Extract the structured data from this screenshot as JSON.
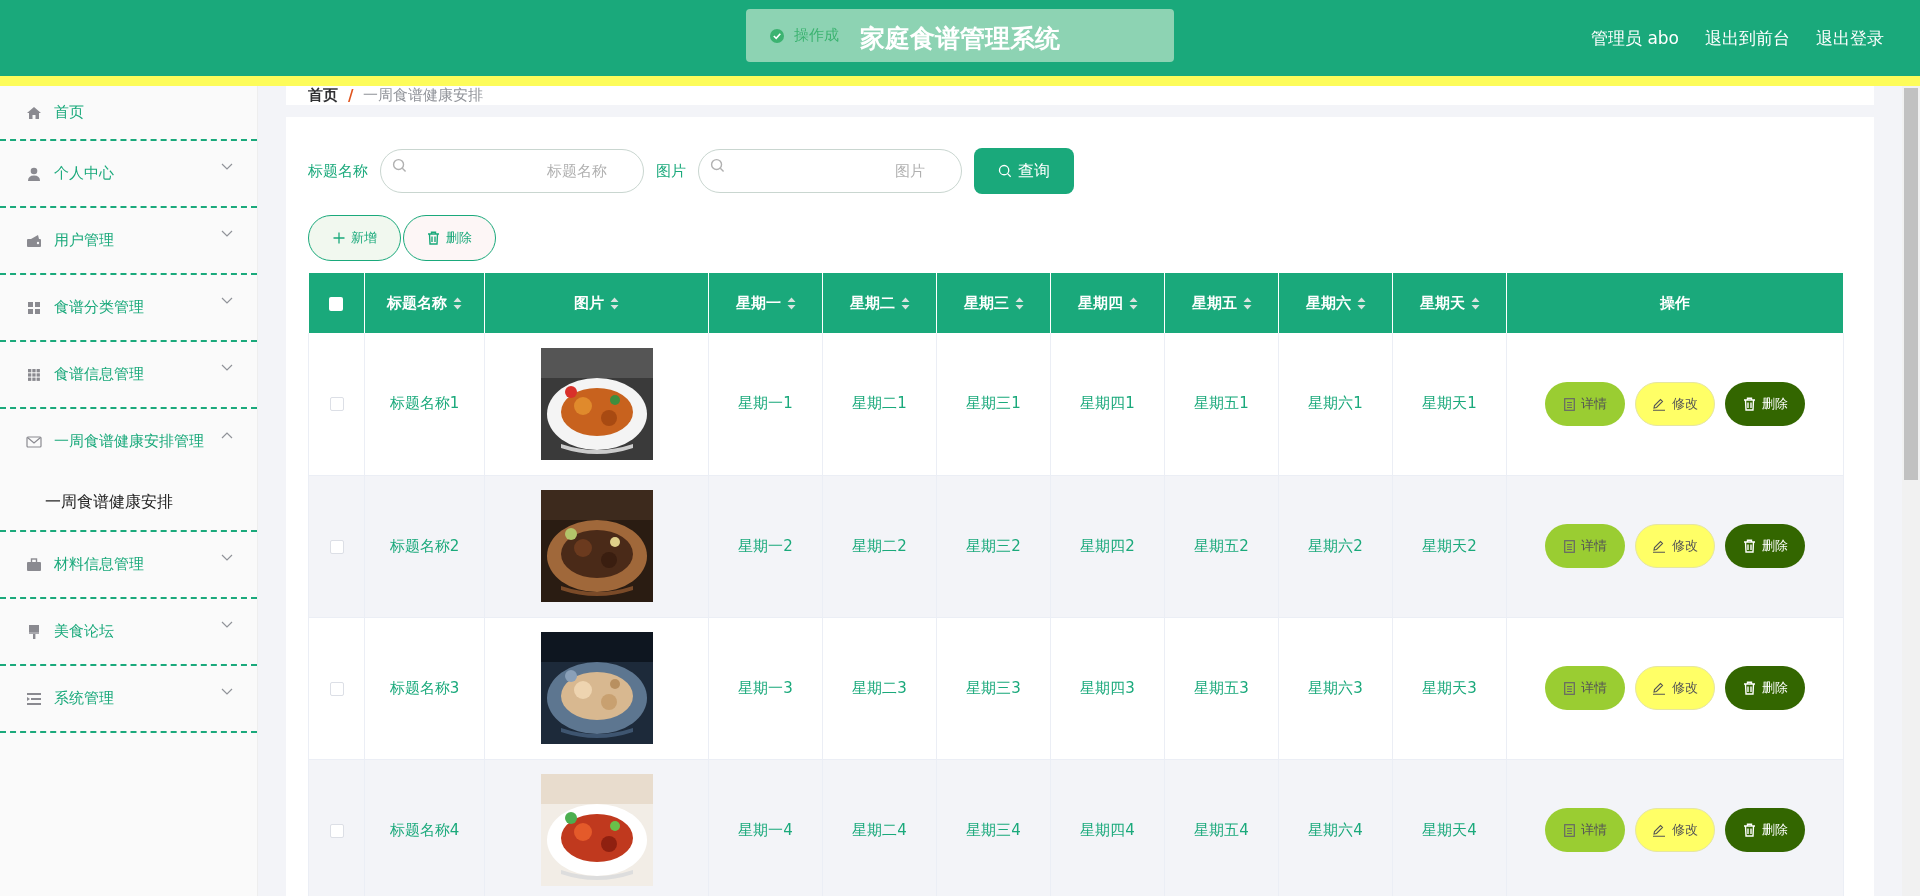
{
  "header": {
    "title": "家庭食谱管理系统",
    "toast": {
      "text": "操作成"
    },
    "links": [
      "管理员 abo",
      "退出到前台",
      "退出登录"
    ]
  },
  "sidebar": {
    "items": [
      {
        "label": "首页",
        "kind": "link"
      },
      {
        "label": "个人中心",
        "kind": "menu",
        "expanded": false
      },
      {
        "label": "用户管理",
        "kind": "menu",
        "expanded": false
      },
      {
        "label": "食谱分类管理",
        "kind": "menu",
        "expanded": false
      },
      {
        "label": "食谱信息管理",
        "kind": "menu",
        "expanded": false
      },
      {
        "label": "一周食谱健康安排管理",
        "kind": "menu",
        "expanded": true,
        "children": [
          {
            "label": "一周食谱健康安排"
          }
        ]
      },
      {
        "label": "材料信息管理",
        "kind": "menu",
        "expanded": false
      },
      {
        "label": "美食论坛",
        "kind": "menu",
        "expanded": false
      },
      {
        "label": "系统管理",
        "kind": "menu",
        "expanded": false
      }
    ]
  },
  "breadcrumb": [
    "首页",
    "一周食谱健康安排"
  ],
  "breadcrumb_separator": "/",
  "search": {
    "fields": [
      {
        "label": "标题名称",
        "placeholder": "标题名称"
      },
      {
        "label": "图片",
        "placeholder": "图片"
      }
    ],
    "button": "查询"
  },
  "actions": [
    {
      "label": "新增",
      "kind": "add"
    },
    {
      "label": "删除",
      "kind": "delete"
    }
  ],
  "table": {
    "header_checkbox": {
      "checked": false
    },
    "columns": [
      {
        "label": "标题名称",
        "sortable": true
      },
      {
        "label": "图片",
        "sortable": true
      },
      {
        "label": "星期一",
        "sortable": true
      },
      {
        "label": "星期二",
        "sortable": true
      },
      {
        "label": "星期三",
        "sortable": true
      },
      {
        "label": "星期四",
        "sortable": true
      },
      {
        "label": "星期五",
        "sortable": true
      },
      {
        "label": "星期六",
        "sortable": true
      },
      {
        "label": "星期天",
        "sortable": true
      },
      {
        "label": "操作",
        "sortable": false
      }
    ],
    "rows": [
      {
        "checked": false,
        "title": "标题名称1",
        "image": {
          "kind": "picture"
        },
        "days": [
          "星期一1",
          "星期二1",
          "星期三1",
          "星期四1",
          "星期五1",
          "星期六1",
          "星期天1"
        ],
        "buttons": [
          {
            "label": "详情",
            "kind": "detail"
          },
          {
            "label": "修改",
            "kind": "edit"
          },
          {
            "label": "删除",
            "kind": "delete"
          }
        ]
      },
      {
        "checked": false,
        "title": "标题名称2",
        "image": {
          "kind": "picture"
        },
        "days": [
          "星期一2",
          "星期二2",
          "星期三2",
          "星期四2",
          "星期五2",
          "星期六2",
          "星期天2"
        ],
        "buttons": [
          {
            "label": "详情",
            "kind": "detail"
          },
          {
            "label": "修改",
            "kind": "edit"
          },
          {
            "label": "删除",
            "kind": "delete"
          }
        ]
      },
      {
        "checked": false,
        "title": "标题名称3",
        "image": {
          "kind": "picture"
        },
        "days": [
          "星期一3",
          "星期二3",
          "星期三3",
          "星期四3",
          "星期五3",
          "星期六3",
          "星期天3"
        ],
        "buttons": [
          {
            "label": "详情",
            "kind": "detail"
          },
          {
            "label": "修改",
            "kind": "edit"
          },
          {
            "label": "删除",
            "kind": "delete"
          }
        ]
      },
      {
        "checked": false,
        "title": "标题名称4",
        "image": {
          "kind": "picture"
        },
        "days": [
          "星期一4",
          "星期二4",
          "星期三4",
          "星期四4",
          "星期五4",
          "星期六4",
          "星期天4"
        ],
        "buttons": [
          {
            "label": "详情",
            "kind": "detail"
          },
          {
            "label": "修改",
            "kind": "edit"
          },
          {
            "label": "删除",
            "kind": "delete"
          }
        ]
      }
    ]
  }
}
